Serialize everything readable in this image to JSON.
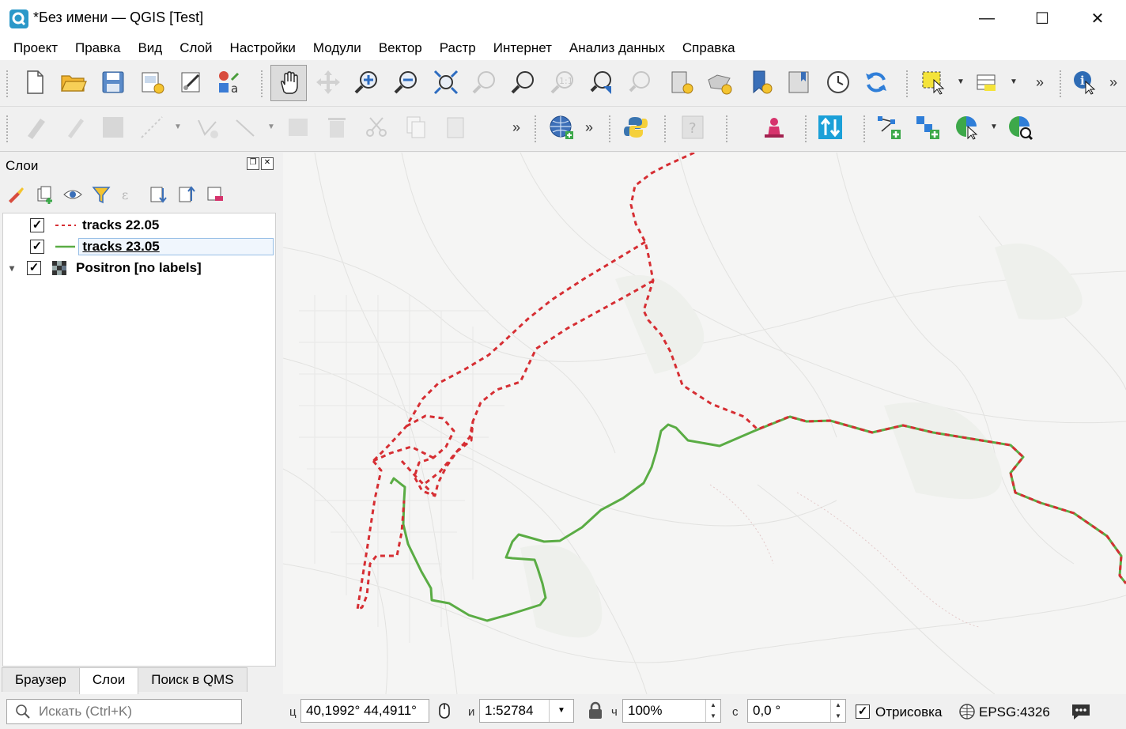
{
  "window": {
    "title": "*Без имени — QGIS [Test]",
    "minimize": "—",
    "maximize": "☐",
    "close": "✕"
  },
  "menu": [
    "Проект",
    "Правка",
    "Вид",
    "Слой",
    "Настройки",
    "Модули",
    "Вектор",
    "Растр",
    "Интернет",
    "Анализ данных",
    "Справка"
  ],
  "toolbar1": {
    "icons": [
      "new-project-icon",
      "open-project-icon",
      "save-project-icon",
      "print-layout-icon",
      "layout-manager-icon",
      "style-manager-icon",
      "pan-icon",
      "pan-to-selection-icon",
      "zoom-in-icon",
      "zoom-out-icon",
      "zoom-full-icon",
      "zoom-to-selection-icon",
      "zoom-to-layer-icon",
      "zoom-native-icon",
      "zoom-last-icon",
      "zoom-next-icon",
      "new-bookmark-icon",
      "show-bookmarks-icon",
      "new-map-view-icon",
      "temporal-controller-icon",
      "refresh-icon",
      "select-features-icon",
      "open-attribute-table-icon",
      "identify-icon"
    ],
    "more": "»"
  },
  "toolbar2": {
    "icons": [
      "current-edits-icon",
      "toggle-editing-icon",
      "save-edits-icon",
      "digitize-icon",
      "vertex-tool-icon",
      "modify-attributes-icon",
      "edit-table-icon",
      "delete-selected-icon",
      "cut-features-icon",
      "copy-features-icon",
      "paste-features-icon",
      "metasearch-icon",
      "python-console-icon",
      "help-icon",
      "geocoder-icon",
      "swap-icon",
      "add-vertex-icon",
      "add-part-icon",
      "select-by-location-icon",
      "identify-search-icon"
    ],
    "more": "»"
  },
  "layers_panel": {
    "title": "Слои",
    "layers": [
      {
        "name": "tracks 22.05",
        "checked": true,
        "style": "dashed",
        "color": "#d62e33"
      },
      {
        "name": "tracks 23.05",
        "checked": true,
        "style": "solid",
        "color": "#5aac44"
      },
      {
        "name": "Positron [no labels]",
        "checked": true,
        "style": "raster",
        "color": "#333333"
      }
    ],
    "check_mark": "✓",
    "expand_arrow": "▾",
    "tabs": [
      "Браузер",
      "Слои",
      "Поиск в QMS"
    ]
  },
  "statusbar": {
    "search_placeholder": "Искать (Ctrl+K)",
    "coord_label": "ц",
    "coordinates": "40,1992°  44,4911°",
    "scale_label": "и",
    "scale": "1:52784",
    "magnifier_label": "ч",
    "magnifier": "100%",
    "rotation_label": "с",
    "rotation": "0,0 °",
    "render_label": "Отрисовка",
    "render_checked": true,
    "crs": "EPSG:4326",
    "check_mark": "✓"
  },
  "colors": {
    "track_2205": "#d62e33",
    "track_2305": "#5aac44",
    "map_bg": "#f4f4f3",
    "qgis_green": "#589632"
  }
}
